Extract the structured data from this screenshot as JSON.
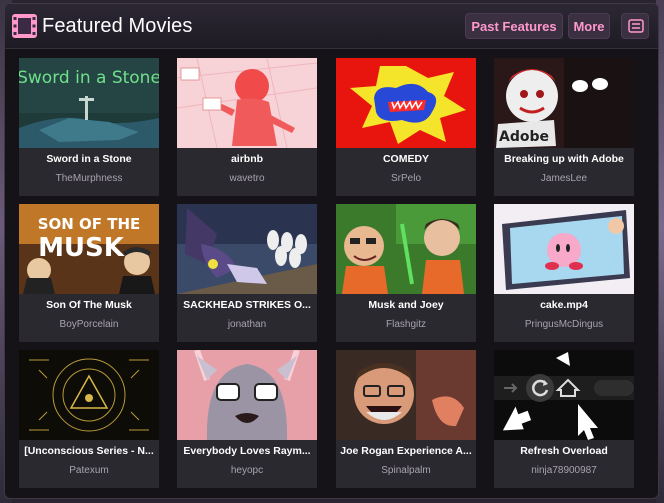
{
  "header": {
    "title": "Featured Movies",
    "past_features_label": "Past Features",
    "more_label": "More"
  },
  "movies": [
    {
      "title": "Sword in a Stone",
      "author": "TheMurphness",
      "thumb_text": "Sword in a Stone"
    },
    {
      "title": "airbnb",
      "author": "wavetro"
    },
    {
      "title": "COMEDY",
      "author": "SrPelo"
    },
    {
      "title": "Breaking up with Adobe",
      "author": "JamesLee",
      "thumb_text": "Adobe"
    },
    {
      "title": "Son Of The Musk",
      "author": "BoyPorcelain",
      "thumb_text_1": "SON OF THE",
      "thumb_text_2": "MUSK"
    },
    {
      "title": "SACKHEAD STRIKES O...",
      "author": "jonathan"
    },
    {
      "title": "Musk and Joey",
      "author": "Flashgitz"
    },
    {
      "title": "cake.mp4",
      "author": "PringusMcDingus"
    },
    {
      "title": "[Unconscious Series - N...",
      "author": "Patexum"
    },
    {
      "title": "Everybody Loves Raym...",
      "author": "heyopc"
    },
    {
      "title": "Joe Rogan Experience A...",
      "author": "Spinalpalm"
    },
    {
      "title": "Refresh Overload",
      "author": "ninja78900987"
    }
  ],
  "colors": {
    "accent": "#ff99cc",
    "panel": "#151317",
    "card": "#2b2930"
  }
}
